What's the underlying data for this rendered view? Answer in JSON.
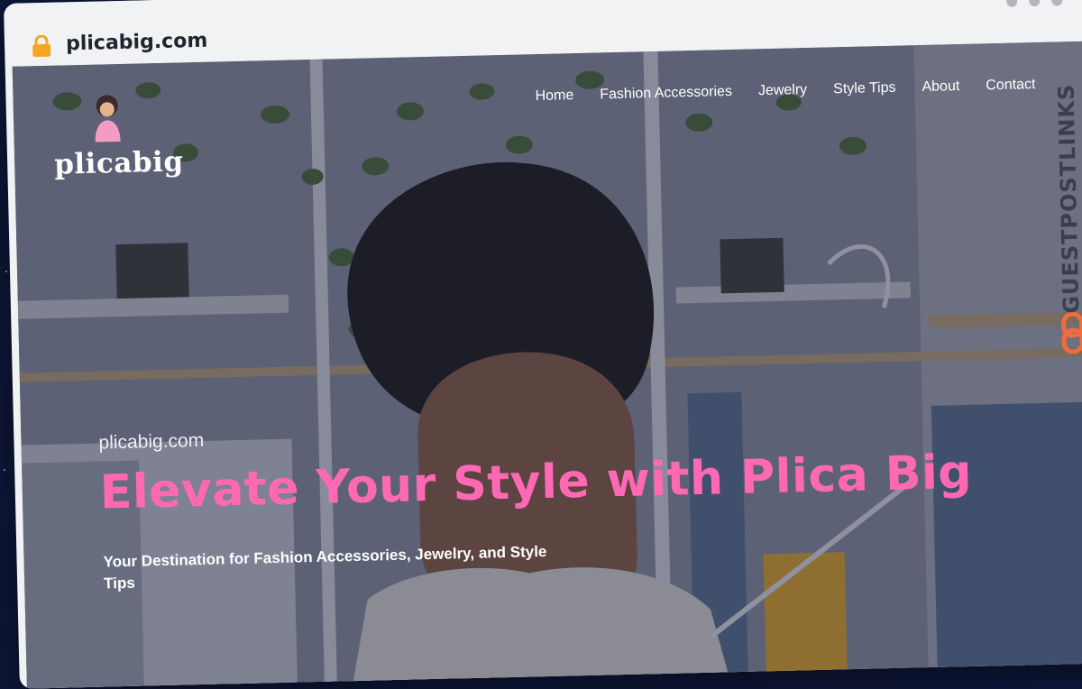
{
  "browser": {
    "url": "plicabig.com",
    "icons": {
      "lock": "lock-icon",
      "window_controls": "dots-icon"
    }
  },
  "site": {
    "logo_text": "plicabig",
    "nav": [
      {
        "label": "Home"
      },
      {
        "label": "Fashion Accessories"
      },
      {
        "label": "Jewelry"
      },
      {
        "label": "Style Tips"
      },
      {
        "label": "About"
      },
      {
        "label": "Contact"
      }
    ],
    "hero": {
      "site_name": "plicabig.com",
      "title": "Elevate Your Style with Plica Big",
      "subtitle": "Your Destination for Fashion Accessories, Jewelry, and Style Tips"
    }
  },
  "badge": {
    "text": "GUESTPOSTLINKS",
    "icon": "link-icon"
  },
  "colors": {
    "accent_pink": "#ff69b4",
    "badge_orange": "#f26b3a",
    "lock_orange": "#f5a623",
    "background": "#0d1738"
  }
}
